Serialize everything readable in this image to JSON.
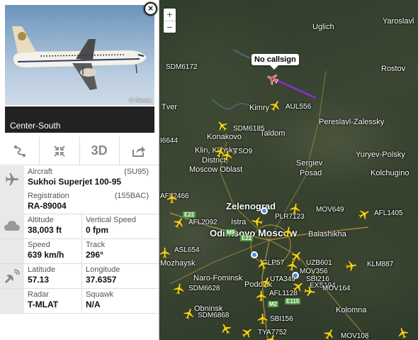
{
  "map": {
    "zoom_in": "+",
    "zoom_out": "−",
    "no_callsign": "No callsign",
    "places": [
      {
        "text": "Uglich"
      },
      {
        "text": "Yaroslavl"
      },
      {
        "text": "Rostov"
      },
      {
        "text": "Tver"
      },
      {
        "text": "Kimry"
      },
      {
        "text": "Taldom"
      },
      {
        "text": "Pereslavl-Zalessky"
      },
      {
        "text": "Konakovo"
      },
      {
        "text": "Klin, Klinsky"
      },
      {
        "text": "District,"
      },
      {
        "text": "Moscow Oblast"
      },
      {
        "text": "Sergiev"
      },
      {
        "text": "Posad"
      },
      {
        "text": "Yuryev-Polsky"
      },
      {
        "text": "Kolchugino"
      },
      {
        "text": "Zelenograd"
      },
      {
        "text": "Istra"
      },
      {
        "text": "Moscow"
      },
      {
        "text": "Balashikha"
      },
      {
        "text": "Odintsovo"
      },
      {
        "text": "Mozhaysk"
      },
      {
        "text": "Naro-Fominsk"
      },
      {
        "text": "Podolsk"
      },
      {
        "text": "Obninsk"
      },
      {
        "text": "Kolomna"
      }
    ],
    "callsigns": [
      {
        "text": "SDM6172"
      },
      {
        "text": "AUL556"
      },
      {
        "text": "SDM6185"
      },
      {
        "text": "I6644"
      },
      {
        "text": "TSO9"
      },
      {
        "text": "AFL2466"
      },
      {
        "text": "AFL2092"
      },
      {
        "text": "PLR7123"
      },
      {
        "text": "MOV649"
      },
      {
        "text": "AFL1405"
      },
      {
        "text": "ASL654"
      },
      {
        "text": "GLP57"
      },
      {
        "text": "UZB601"
      },
      {
        "text": "MOV356"
      },
      {
        "text": "KLM887"
      },
      {
        "text": "UTA349"
      },
      {
        "text": "SBI216"
      },
      {
        "text": "EXS194"
      },
      {
        "text": "SDM6628"
      },
      {
        "text": "AFL1128"
      },
      {
        "text": "MOV164"
      },
      {
        "text": "SDM6868"
      },
      {
        "text": "SBI156"
      },
      {
        "text": "TYA7752"
      },
      {
        "text": "MOV108"
      }
    ],
    "roads": [
      "E22",
      "M9",
      "E22",
      "M2",
      "E115"
    ]
  },
  "panel": {
    "close_label": "×",
    "photo_credit": "© Alexey",
    "route": "Center-South",
    "actions": {
      "route_icon": "route-icon",
      "fullscreen_icon": "collapse-icon",
      "threed_label": "3D",
      "share_icon": "share-icon"
    },
    "aircraft_label": "Aircraft",
    "aircraft_code": "(SU95)",
    "aircraft_value": "Sukhoi Superjet 100-95",
    "registration_label": "Registration",
    "registration_code": "(155BAC)",
    "registration_value": "RA-89004",
    "altitude_label": "Altitude",
    "altitude_value": "38,003 ft",
    "vspeed_label": "Vertical Speed",
    "vspeed_value": "0 fpm",
    "speed_label": "Speed",
    "speed_value": "639 km/h",
    "track_label": "Track",
    "track_value": "296°",
    "latitude_label": "Latitude",
    "latitude_value": "57.13",
    "longitude_label": "Longitude",
    "longitude_value": "37.6357",
    "radar_label": "Radar",
    "radar_value": "T-MLAT",
    "squawk_label": "Squawk",
    "squawk_value": "N/A"
  },
  "colors": {
    "plane": "#f6d61b",
    "selected_plane": "#e0262b",
    "trail": "#8e2bd6",
    "airport": "#4a90e2"
  }
}
